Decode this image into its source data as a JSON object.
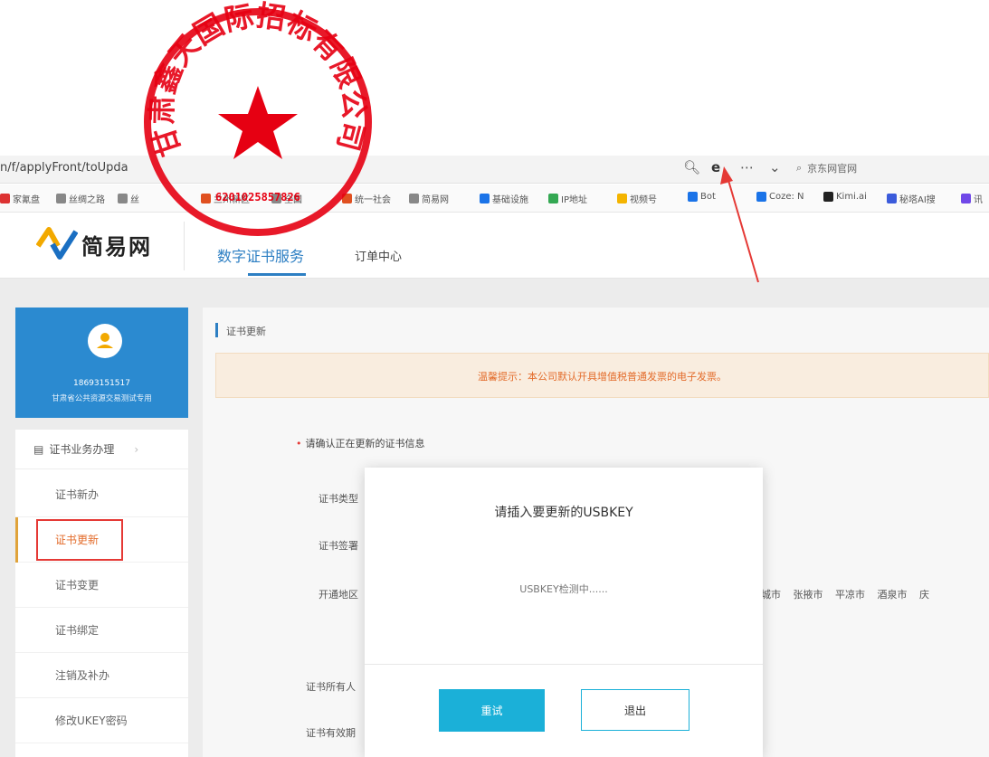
{
  "browser": {
    "url": "n/f/applyFront/toUpda",
    "search_placeholder": "京东网官网",
    "bookmarks": [
      {
        "label": "家氰盘",
        "color": "#d33"
      },
      {
        "label": "丝绸之路",
        "color": "#888"
      },
      {
        "label": "丝",
        "color": "#888"
      },
      {
        "label": "兰州新区",
        "color": "#e05020"
      },
      {
        "label": "全国",
        "color": "#888"
      },
      {
        "label": "统一社会",
        "color": "#e05020"
      },
      {
        "label": "简易网",
        "color": "#888"
      },
      {
        "label": "基础设施",
        "color": "#1a73e8"
      },
      {
        "label": "IP地址",
        "color": "#34a853"
      },
      {
        "label": "视频号",
        "color": "#f4b400"
      },
      {
        "label": "Bot",
        "color": "#1a73e8"
      },
      {
        "label": "Coze: N",
        "color": "#1a73e8"
      },
      {
        "label": "Kimi.ai",
        "color": "#222"
      },
      {
        "label": "秘塔AI搜",
        "color": "#3b5bdb"
      },
      {
        "label": "讯",
        "color": "#7048e8"
      }
    ]
  },
  "header": {
    "logo": "简易网",
    "nav": [
      {
        "label": "数字证书服务",
        "active": true
      },
      {
        "label": "订单中心",
        "active": false
      }
    ]
  },
  "profile": {
    "phone": "18693151517",
    "org": "甘肃省公共资源交易测试专用"
  },
  "sidebar": {
    "group": "证书业务办理",
    "items": [
      {
        "label": "证书新办"
      },
      {
        "label": "证书更新"
      },
      {
        "label": "证书变更"
      },
      {
        "label": "证书绑定"
      },
      {
        "label": "注销及补办"
      },
      {
        "label": "修改UKEY密码"
      }
    ]
  },
  "main": {
    "section_title": "证书更新",
    "notice": "温馨提示：本公司默认开具增值税普通发票的电子发票。",
    "confirm_label": "请确认正在更新的证书信息",
    "fields": [
      "证书类型",
      "证书签署",
      "开通地区",
      "证书所有人",
      "证书有效期"
    ],
    "cities": "金城市 张掖市 平凉市 酒泉市 庆"
  },
  "modal": {
    "title": "请插入要更新的USBKEY",
    "status": "USBKEY检测中......",
    "retry": "重试",
    "exit": "退出"
  },
  "seal": {
    "text": "甘肃鑫天国际招标有限公司",
    "number": "6201025857826"
  },
  "colors": {
    "accent": "#2d7fc3",
    "profile_card": "#2b8ad0",
    "button": "#1bb0d8",
    "notice": "#e36c2b",
    "seal": "#e60012",
    "highlight_box": "#e53935"
  }
}
